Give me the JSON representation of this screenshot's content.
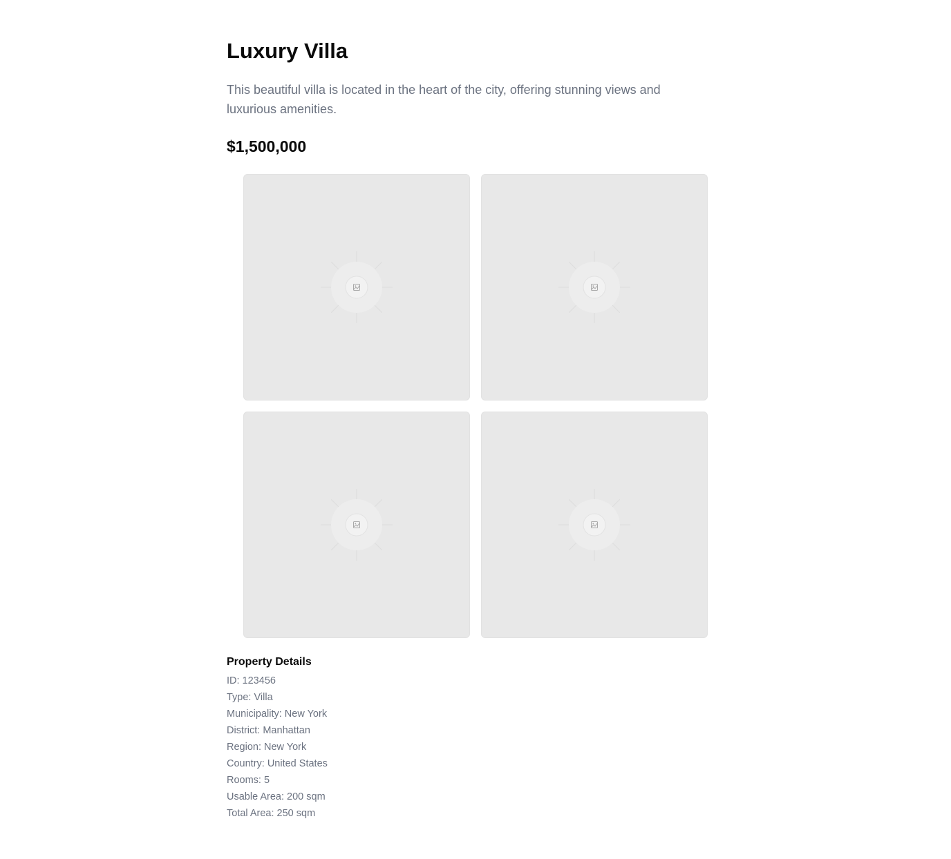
{
  "listing": {
    "title": "Luxury Villa",
    "description": "This beautiful villa is located in the heart of the city, offering stunning views and luxurious amenities.",
    "price": "$1,500,000"
  },
  "gallery": {
    "images": [
      {
        "icon": "image-placeholder-icon"
      },
      {
        "icon": "image-placeholder-icon"
      },
      {
        "icon": "image-placeholder-icon"
      },
      {
        "icon": "image-placeholder-icon"
      }
    ]
  },
  "details": {
    "heading": "Property Details",
    "items": [
      "ID: 123456",
      "Type: Villa",
      "Municipality: New York",
      "District: Manhattan",
      "Region: New York",
      "Country: United States",
      "Rooms: 5",
      "Usable Area: 200 sqm",
      "Total Area: 250 sqm"
    ]
  },
  "colors": {
    "heading": "#0a0a0a",
    "muted_text": "#6b7280",
    "placeholder_bg": "#e8e8e8"
  }
}
